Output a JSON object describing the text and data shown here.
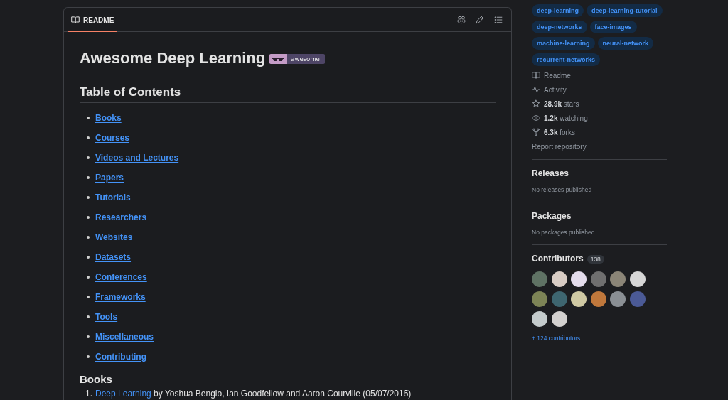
{
  "readme": {
    "tab": {
      "label": "README",
      "selected": true
    },
    "title": "Awesome Deep Learning",
    "badge": "awesome",
    "toc_heading": "Table of Contents",
    "toc": [
      "Books",
      "Courses",
      "Videos and Lectures",
      "Papers",
      "Tutorials",
      "Researchers",
      "Websites",
      "Datasets",
      "Conferences",
      "Frameworks",
      "Tools",
      "Miscellaneous",
      "Contributing"
    ],
    "section_heading": "Books",
    "books": [
      {
        "number": "1.",
        "title": "Deep Learning",
        "details": "by Yoshua Bengio, Ian Goodfellow and Aaron Courville (05/07/2015)"
      }
    ]
  },
  "sidebar": {
    "topics": [
      "deep-learning",
      "deep-learning-tutorial",
      "deep-networks",
      "face-images",
      "machine-learning",
      "neural-network",
      "recurrent-networks"
    ],
    "links": [
      {
        "kind": "readme",
        "label": "Readme"
      },
      {
        "kind": "activity",
        "label": "Activity"
      },
      {
        "kind": "stars",
        "count": "28.9k",
        "label": "stars"
      },
      {
        "kind": "watching",
        "count": "1.2k",
        "label": "watching"
      },
      {
        "kind": "forks",
        "count": "6.3k",
        "label": "forks"
      },
      {
        "kind": "report",
        "label": "Report repository"
      }
    ],
    "releases": {
      "heading": "Releases",
      "note": "No releases published"
    },
    "packages": {
      "heading": "Packages",
      "note": "No packages published"
    },
    "contributors": {
      "heading": "Contributors",
      "count": "138",
      "more": "+ 124 contributors"
    }
  }
}
